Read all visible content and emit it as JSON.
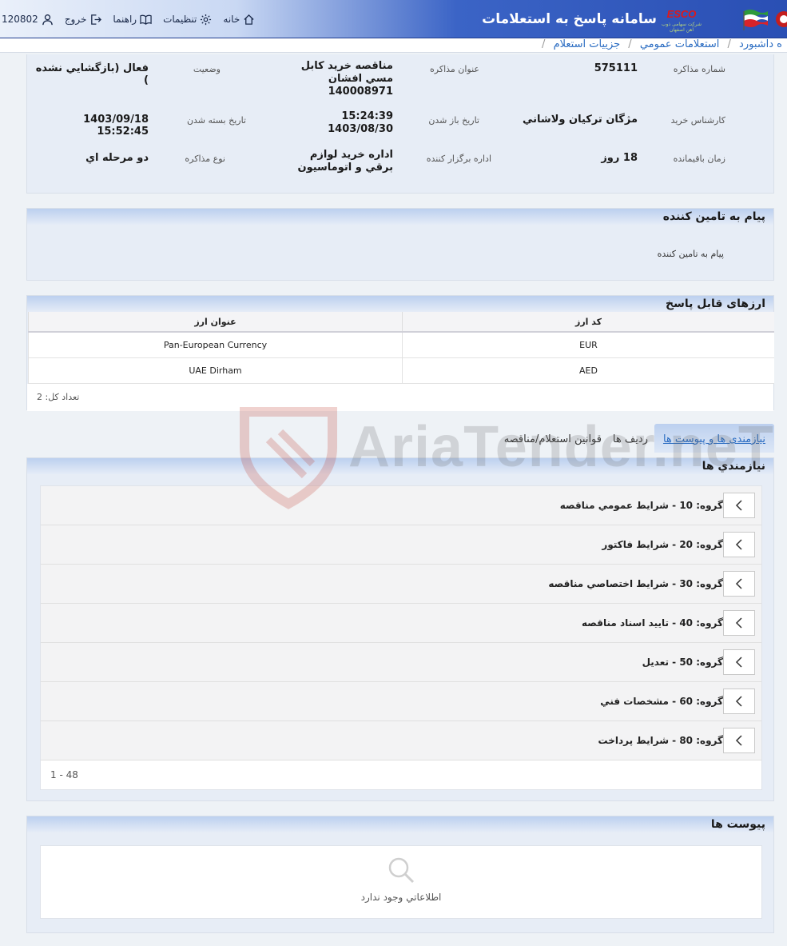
{
  "header": {
    "user_id": "120802",
    "nav": {
      "logout": "خروج",
      "help": "راهنما",
      "settings": "تنظیمات",
      "home": "خانه"
    },
    "system_title": "سامانه پاسخ به استعلامات",
    "logo": {
      "brand": "ESCO",
      "tagline": "شرکت سهامی ذوب آهن اصفهان"
    }
  },
  "breadcrumb": [
    "ه داشبورد",
    "استعلامات عمومي",
    "جزييات استعلام"
  ],
  "details": {
    "number_label": "شماره مذاكره",
    "number_value": "575111",
    "title_label": "عنوان مذاكره",
    "title_value": "مناقصه خريد كابل مسي افشان 140008971",
    "status_label": "وضعيت",
    "status_value": "فعال (بازگشايي نشده )",
    "expert_label": "كارشناس خريد",
    "expert_value": "مژگان تركيان ولاشاني",
    "open_label": "تاريخ باز شدن",
    "open_value_time": "15:24:39",
    "open_value_date": "1403/08/30",
    "close_label": "تاريخ بسته شدن",
    "close_value": "1403/09/18 15:52:45",
    "remaining_label": "زمان باقيمانده",
    "remaining_value": "18 روز",
    "dept_label": "اداره برگزار كننده",
    "dept_value": "اداره خريد لوازم برقي و اتوماسيون",
    "type_label": "نوع مذاكره",
    "type_value": "دو مرحله اي"
  },
  "message_panel": {
    "title": "پيام به تامين كننده",
    "body": "پيام به تامين كننده"
  },
  "currency_panel": {
    "title": "ارزهای قابل پاسخ",
    "columns": {
      "code": "كد ارز",
      "name": "عنوان ارز"
    },
    "rows": [
      {
        "code": "EUR",
        "name": "Pan-European Currency"
      },
      {
        "code": "AED",
        "name": "UAE Dirham"
      }
    ],
    "total": "تعداد کل: 2"
  },
  "tabs": [
    "نیازمندی ها و پیوست ها",
    "رديف ها",
    "قوانين استعلام/مناقصه"
  ],
  "requirements": {
    "title": "نيازمندي ها",
    "groups": [
      "گروه: 10 - شرايط عمومي مناقصه",
      "گروه: 20 - شرايط فاكتور",
      "گروه: 30 - شرايط اختصاصي مناقصه",
      "گروه: 40 - تاييد اسناد مناقصه",
      "گروه: 50 - تعديل",
      "گروه: 60 - مشخصات فني",
      "گروه: 80 - شرايط پرداخت"
    ],
    "pager": "1 - 48"
  },
  "attachments": {
    "title": "پيوست ها",
    "empty": "اطلاعاتي وجود ندارد"
  },
  "watermark": "AriaTender.neT",
  "colors": {
    "accent": "#2a6cc2",
    "header_blue": "#2a4fb4",
    "watermark_red": "#c0392b"
  }
}
